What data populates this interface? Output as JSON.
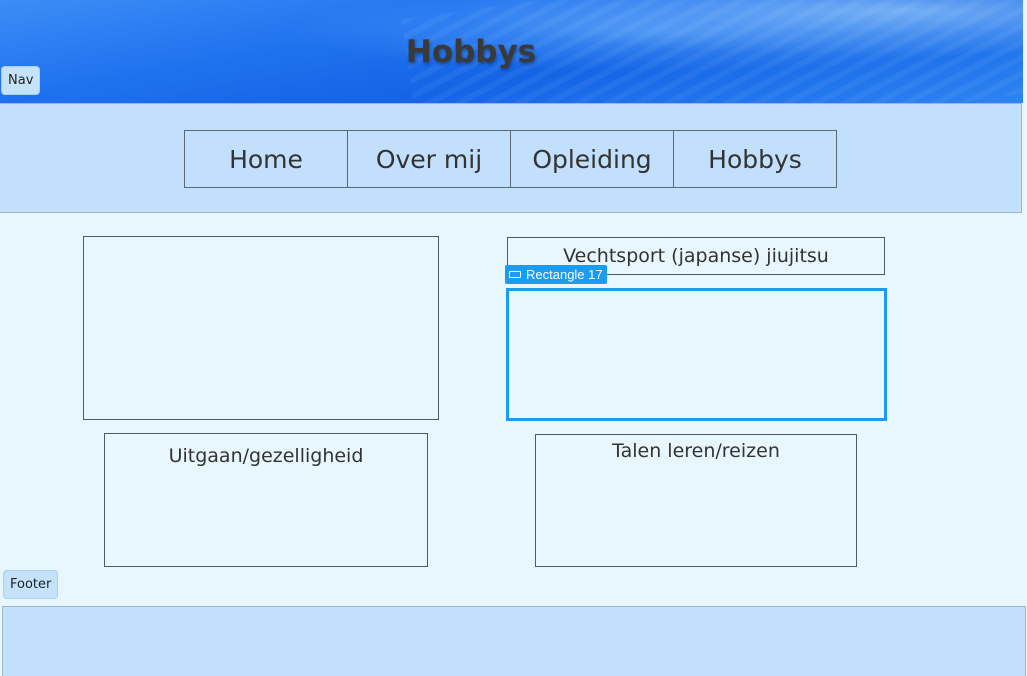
{
  "header": {
    "title": "Hobbys"
  },
  "frame_tags": {
    "nav": "Nav",
    "footer": "Footer"
  },
  "nav": {
    "items": [
      {
        "label": "Home"
      },
      {
        "label": "Over mij"
      },
      {
        "label": "Opleiding"
      },
      {
        "label": "Hobbys"
      }
    ]
  },
  "hobbies": {
    "martial_arts": "Vechtsport (japanse) jiujitsu",
    "going_out": "Uitgaan/gezelligheid",
    "languages_travel": "Talen leren/reizen"
  },
  "selection": {
    "label": "Rectangle 17",
    "icon": "rectangle-icon",
    "color": "#1a9cf0"
  },
  "colors": {
    "panel": "#c2e0fb",
    "background": "#e8f7fd",
    "selection": "#1a9cf0"
  }
}
